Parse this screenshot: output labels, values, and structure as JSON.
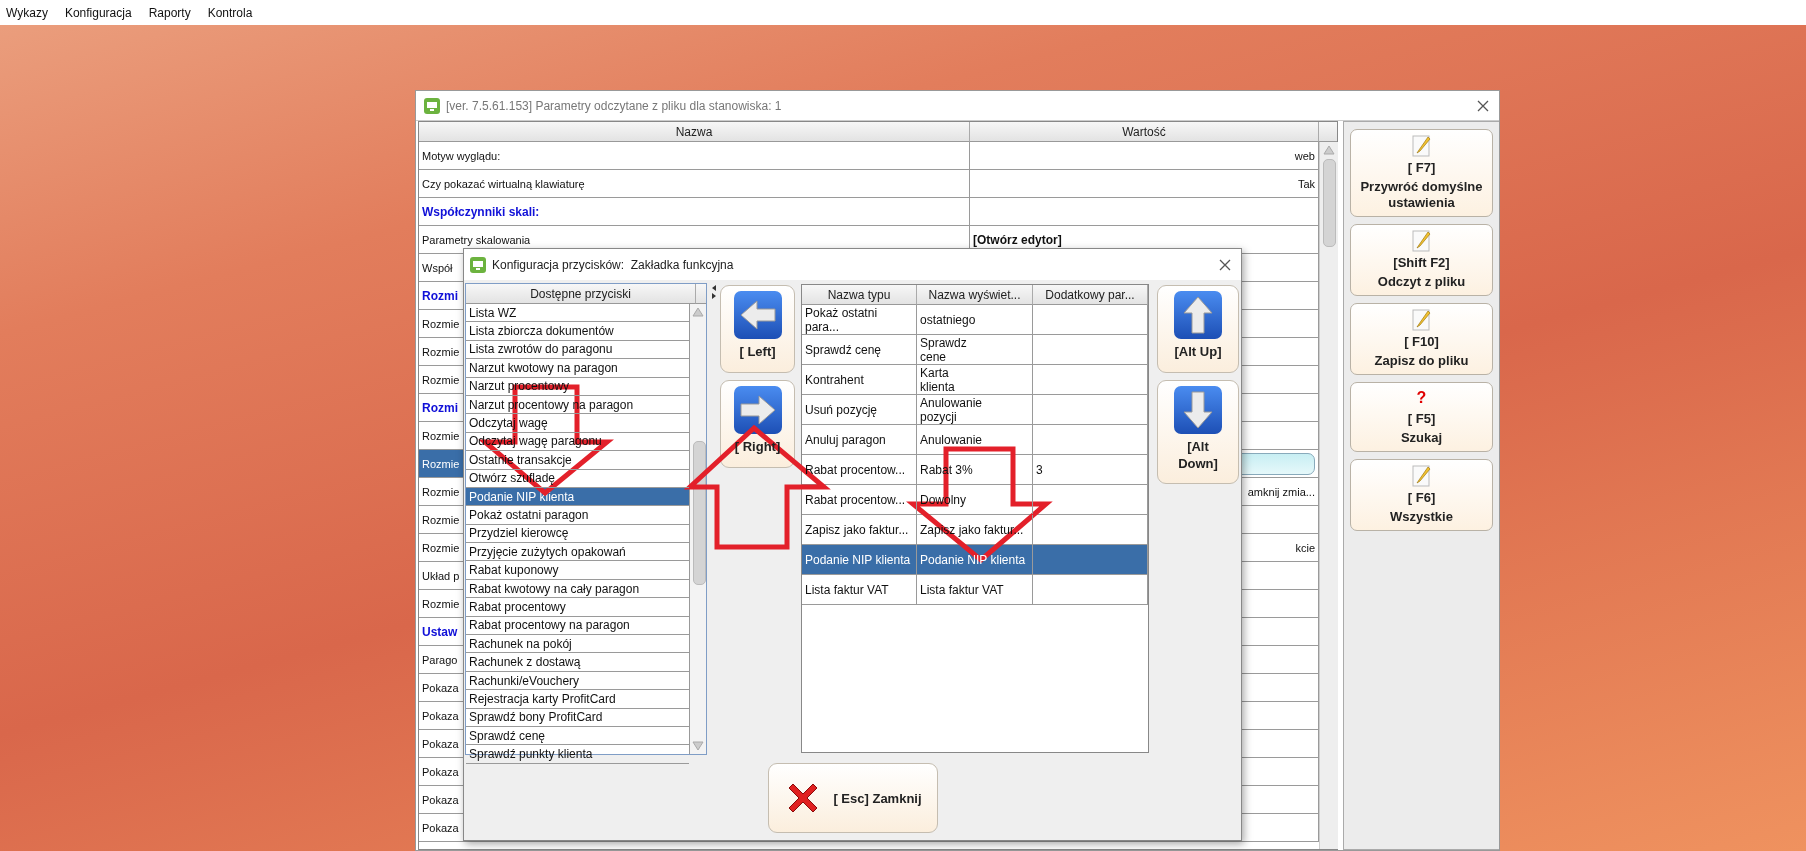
{
  "menu": [
    "Wykazy",
    "Konfiguracja",
    "Raporty",
    "Kontrola"
  ],
  "settings_window": {
    "title": "[ver. 7.5.61.153] Parametry odczytane z pliku dla stanowiska: 1",
    "columns": [
      "Nazwa",
      "Wartość"
    ],
    "rows": [
      {
        "kind": "param",
        "name": "Motyw wyglądu:",
        "value": "web",
        "selected": false
      },
      {
        "kind": "param",
        "name": "Czy pokazać wirtualną klawiaturę",
        "value": "Tak",
        "selected": false
      },
      {
        "kind": "header",
        "name": "Współczynniki skali:",
        "selected": false
      },
      {
        "kind": "action",
        "name": "Parametry skalowania",
        "value": "[Otwórz edytor]",
        "selected": false
      },
      {
        "kind": "param",
        "name": "Współ",
        "selected": false
      },
      {
        "kind": "header",
        "name": "Rozmi",
        "selected": false
      },
      {
        "kind": "param",
        "name": "Rozmie",
        "selected": false
      },
      {
        "kind": "param",
        "name": "Rozmie",
        "selected": false
      },
      {
        "kind": "param",
        "name": "Rozmie",
        "selected": false
      },
      {
        "kind": "header",
        "name": "Rozmi",
        "selected": false
      },
      {
        "kind": "param",
        "name": "Rozmie",
        "selected": false
      },
      {
        "kind": "param",
        "name": "Rozmie",
        "selected": true
      },
      {
        "kind": "param",
        "name": "Rozmie",
        "value": "amknij zmia...",
        "selected": false
      },
      {
        "kind": "param",
        "name": "Rozmie",
        "selected": false
      },
      {
        "kind": "param",
        "name": "Rozmie",
        "value": "kcie",
        "selected": false
      },
      {
        "kind": "param",
        "name": "Układ p",
        "selected": false
      },
      {
        "kind": "param",
        "name": "Rozmie",
        "selected": false
      },
      {
        "kind": "header",
        "name": "Ustaw",
        "selected": false
      },
      {
        "kind": "param",
        "name": "Parago",
        "selected": false
      },
      {
        "kind": "param",
        "name": "Pokaza",
        "selected": false
      },
      {
        "kind": "param",
        "name": "Pokaza",
        "selected": false
      },
      {
        "kind": "param",
        "name": "Pokaza",
        "selected": false
      },
      {
        "kind": "param",
        "name": "Pokaza",
        "selected": false
      },
      {
        "kind": "param",
        "name": "Pokaza",
        "selected": false
      },
      {
        "kind": "param",
        "name": "Pokaza",
        "selected": false
      }
    ],
    "side_buttons": [
      {
        "kind": "pencil",
        "key": "[ F7]",
        "label": "Przywróć domyślne ustawienia"
      },
      {
        "kind": "pencil",
        "key": "[Shift F2]",
        "label": "Odczyt z pliku"
      },
      {
        "kind": "pencil",
        "key": "[ F10]",
        "label": "Zapisz do pliku"
      },
      {
        "kind": "help",
        "glyph": "?",
        "key": "[ F5]",
        "label": "Szukaj"
      },
      {
        "kind": "pencil",
        "key": "[ F6]",
        "label": "Wszystkie"
      }
    ]
  },
  "dialog": {
    "title": "Konfiguracja przycisków:  Zakładka funkcyjna",
    "available": {
      "header": "Dostępne przyciski",
      "items": [
        {
          "label": "Lista WZ",
          "selected": false
        },
        {
          "label": "Lista zbiorcza dokumentów",
          "selected": false
        },
        {
          "label": "Lista zwrotów do paragonu",
          "selected": false
        },
        {
          "label": "Narzut kwotowy na paragon",
          "selected": false
        },
        {
          "label": "Narzut procentowy",
          "selected": false
        },
        {
          "label": "Narzut procentowy na paragon",
          "selected": false
        },
        {
          "label": "Odczytaj wagę",
          "selected": false
        },
        {
          "label": "Odczytaj wagę paragonu",
          "selected": false
        },
        {
          "label": "Ostatnie transakcje",
          "selected": false
        },
        {
          "label": "Otwórz szufladę",
          "selected": false
        },
        {
          "label": "Podanie NIP klienta",
          "selected": true
        },
        {
          "label": "Pokaż ostatni paragon",
          "selected": false
        },
        {
          "label": "Przydziel kierowcę",
          "selected": false
        },
        {
          "label": "Przyjęcie zużytych opakowań",
          "selected": false
        },
        {
          "label": "Rabat kuponowy",
          "selected": false
        },
        {
          "label": "Rabat kwotowy na cały paragon",
          "selected": false
        },
        {
          "label": "Rabat procentowy",
          "selected": false
        },
        {
          "label": "Rabat procentowy na paragon",
          "selected": false
        },
        {
          "label": "Rachunek na pokój",
          "selected": false
        },
        {
          "label": "Rachunek z dostawą",
          "selected": false
        },
        {
          "label": "Rachunki/eVouchery",
          "selected": false
        },
        {
          "label": "Rejestracja karty ProfitCard",
          "selected": false
        },
        {
          "label": "Sprawdź bony ProfitCard",
          "selected": false
        },
        {
          "label": "Sprawdź cenę",
          "selected": false
        },
        {
          "label": "Sprawdź punkty klienta",
          "selected": false
        }
      ]
    },
    "move_buttons": [
      {
        "kind": "left",
        "label": "[ Left]"
      },
      {
        "kind": "right",
        "label": "[ Right]"
      }
    ],
    "table": {
      "columns": [
        "Nazwa typu",
        "Nazwa wyświet...",
        "Dodatkowy par..."
      ],
      "rows": [
        {
          "type": "Pokaż ostatni para...",
          "display": "ostatniego",
          "selected": false
        },
        {
          "type": "Sprawdź cenę",
          "display": "Sprawdz\ncene",
          "selected": false
        },
        {
          "type": "Kontrahent",
          "display": "Karta\nklienta",
          "selected": false
        },
        {
          "type": "Usuń pozycję",
          "display": "Anulowanie\npozycji",
          "selected": false
        },
        {
          "type": "Anuluj paragon",
          "display": "Anulowanie",
          "selected": false
        },
        {
          "type": "Rabat procentow...",
          "display": "Rabat 3%",
          "extra": "3",
          "selected": false
        },
        {
          "type": "Rabat procentow...",
          "display": "Dowolny",
          "selected": false
        },
        {
          "type": "Zapisz jako faktur...",
          "display": "Zapisz jako faktur...",
          "selected": false
        },
        {
          "type": "Podanie NIP klienta",
          "display": "Podanie NIP klienta",
          "selected": true
        },
        {
          "type": "Lista faktur VAT",
          "display": "Lista faktur VAT",
          "selected": false
        }
      ]
    },
    "order_buttons": [
      {
        "kind": "up",
        "label": "[Alt Up]"
      },
      {
        "kind": "down",
        "label": "[Alt Down]"
      }
    ],
    "close_button": {
      "label": "[ Esc] Zamknij"
    }
  }
}
